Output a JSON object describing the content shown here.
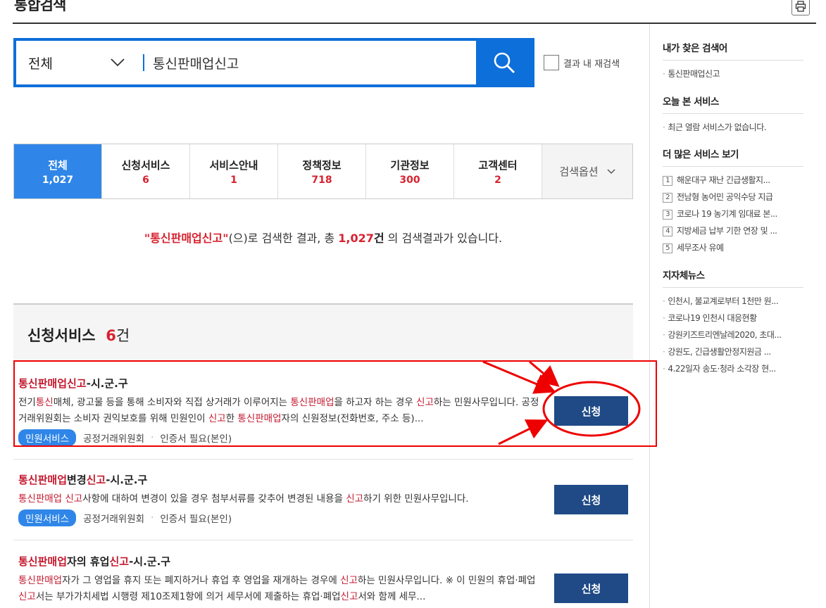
{
  "header": {
    "title": "통합검색",
    "print_icon": "printer-icon"
  },
  "search": {
    "category": "전체",
    "query": "통신판매업신고",
    "research_label": "결과 내 재검색"
  },
  "tabs": [
    {
      "label": "전체",
      "count": "1,027"
    },
    {
      "label": "신청서비스",
      "count": "6"
    },
    {
      "label": "서비스안내",
      "count": "1"
    },
    {
      "label": "정책정보",
      "count": "718"
    },
    {
      "label": "기관정보",
      "count": "300"
    },
    {
      "label": "고객센터",
      "count": "2"
    }
  ],
  "options_label": "검색옵션",
  "summary": {
    "query_quoted": "\"통신판매업신고\"",
    "mid": "(으)로 검색한 결과, 총 ",
    "total": "1,027",
    "unit": "건",
    "tail": " 의 검색결과가 있습니다."
  },
  "section": {
    "title": "신청서비스",
    "count": "6",
    "unit": "건"
  },
  "items": [
    {
      "title_hl": "통신판매업신고",
      "title_rest": "-시.군.구",
      "desc": "전기통신매체, 광고물 등을 통해 소비자와 직접 상거래가 이루어지는 통신판매업을 하고자 하는 경우 신고하는 민원사무입니다. 공정거래위원회는 소비자 권익보호를 위해 민원인이 신고한 통신판매업자의 신원정보(전화번호, 주소 등)...",
      "badge": "민원서비스",
      "agency": "공정거래위원회",
      "cert": "인증서 필요(본인)",
      "button": "신청"
    },
    {
      "title_a": "통신판매업",
      "title_b": "변경",
      "title_c": "신고",
      "title_d": "-시.군.구",
      "desc_a": "통신판매업 신고",
      "desc_b": "사항에 대하여 변경이 있을 경우 첨부서류를 갖추어 변경된 내용을 ",
      "desc_c": "신고",
      "desc_d": "하기 위한 민원사무입니다.",
      "badge": "민원서비스",
      "agency": "공정거래위원회",
      "cert": "인증서 필요(본인)",
      "button": "신청"
    },
    {
      "title_a": "통신판매업",
      "title_b": "자의 휴업",
      "title_c": "신고",
      "title_d": "-시.군.구",
      "desc_a": "통신판매업",
      "desc_b": "자가 그 영업을 휴지 또는 폐지하거나 휴업 후 영업을 재개하는 경우에 ",
      "desc_c": "신고",
      "desc_d": "하는 민원사무입니다. ※ 이 민원의 휴업·폐업",
      "desc_e": "신고",
      "desc_f": "서는 부가가치세법 시행령 제10조제1항에 의거 세무서에 제출하는 휴업·폐업",
      "desc_g": "신고",
      "desc_h": "서와 함께 세무...",
      "button": "신청"
    }
  ],
  "sidebar": {
    "my_search_title": "내가 찾은 검색어",
    "my_search": [
      "통신판매업신고"
    ],
    "today_title": "오늘 본 서비스",
    "today_empty": "최근 열람 서비스가 없습니다.",
    "more_title": "더 많은 서비스 보기",
    "more": [
      {
        "n": "1",
        "text": "해운대구 재난 긴급생활지..."
      },
      {
        "n": "2",
        "text": "전남형 농어민 공익수당 지급"
      },
      {
        "n": "3",
        "text": "코로나 19 농기계 임대료 본..."
      },
      {
        "n": "4",
        "text": "지방세금 납부 기한 연장 및 ..."
      },
      {
        "n": "5",
        "text": "세무조사 유예"
      }
    ],
    "news_title": "지자체뉴스",
    "news": [
      "인천시, 불교계로부터 1천만 원...",
      "코로나19 인천시 대응현황",
      "강원키즈트리엔날레2020, 초대...",
      "강원도, 긴급생활안정지원금 ...",
      "4.22일자 송도·청라 소각장 현..."
    ]
  }
}
